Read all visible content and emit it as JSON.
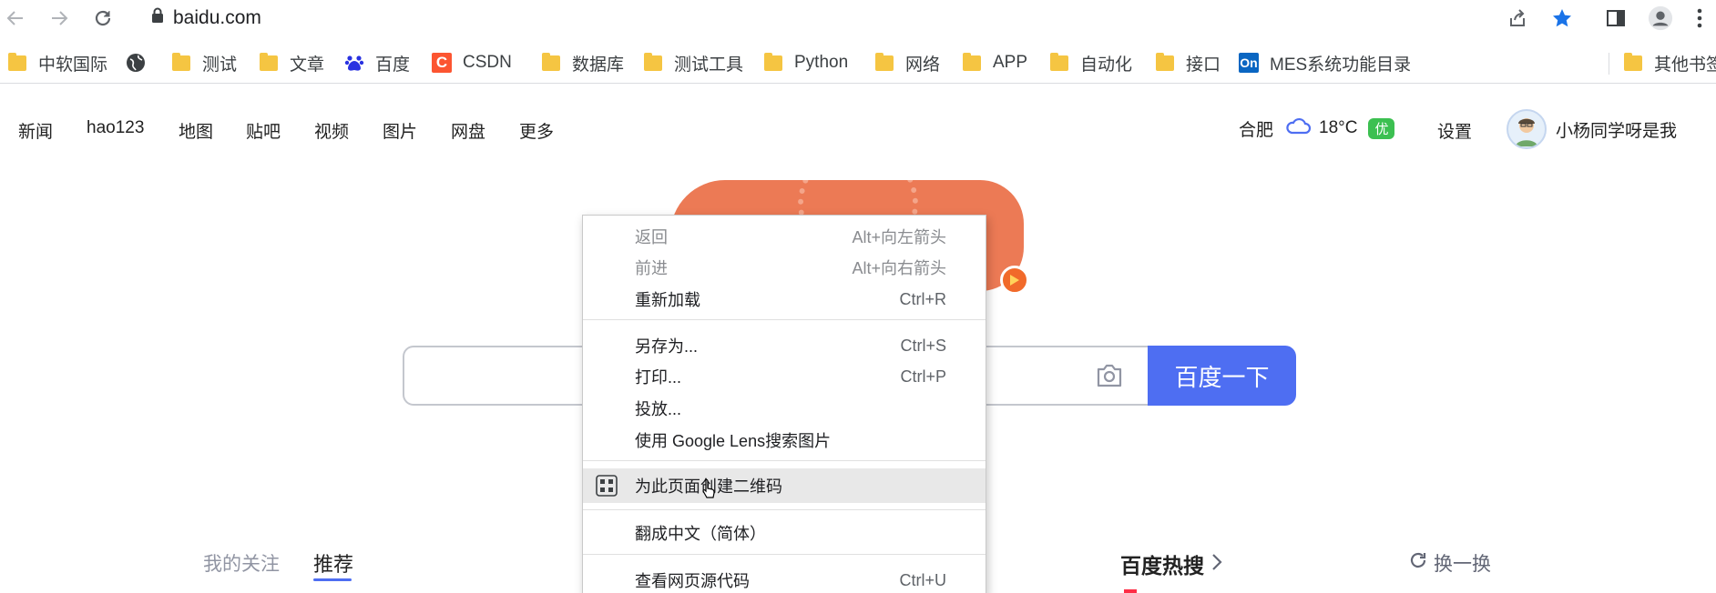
{
  "browser": {
    "url": "baidu.com"
  },
  "bookmarks": [
    {
      "label": "中软国际",
      "icon": "folder-icon"
    },
    {
      "label": "",
      "icon": "globe-icon"
    },
    {
      "label": "测试",
      "icon": "folder-icon"
    },
    {
      "label": "文章",
      "icon": "folder-icon"
    },
    {
      "label": "百度",
      "icon": "baidu-paw-icon"
    },
    {
      "label": "CSDN",
      "icon": "csdn-icon"
    },
    {
      "label": "数据库",
      "icon": "folder-icon"
    },
    {
      "label": "测试工具",
      "icon": "folder-icon"
    },
    {
      "label": "Python",
      "icon": "folder-icon"
    },
    {
      "label": "网络",
      "icon": "folder-icon"
    },
    {
      "label": "APP",
      "icon": "folder-icon"
    },
    {
      "label": "自动化",
      "icon": "folder-icon"
    },
    {
      "label": "接口",
      "icon": "folder-icon"
    },
    {
      "label": "MES系统功能目录",
      "icon": "on-icon"
    },
    {
      "label": "其他书签",
      "icon": "folder-icon"
    }
  ],
  "csdn_glyph": "C",
  "on_glyph": "On",
  "nav": [
    "新闻",
    "hao123",
    "地图",
    "贴吧",
    "视频",
    "图片",
    "网盘",
    "更多"
  ],
  "weather": {
    "city": "合肥",
    "temp": "18°C",
    "air_quality": "优"
  },
  "settings_label": "设置",
  "user_name": "小杨同学呀是我",
  "search": {
    "button_label": "百度一下"
  },
  "tabs": {
    "follow": "我的关注",
    "recommend": "推荐"
  },
  "hot": {
    "title": "百度热搜",
    "refresh": "换一换"
  },
  "context_menu": [
    {
      "label": "返回",
      "shortcut": "Alt+向左箭头",
      "disabled": true
    },
    {
      "label": "前进",
      "shortcut": "Alt+向右箭头",
      "disabled": true
    },
    {
      "label": "重新加载",
      "shortcut": "Ctrl+R",
      "disabled": false
    },
    {
      "label": "另存为...",
      "shortcut": "Ctrl+S",
      "disabled": false
    },
    {
      "label": "打印...",
      "shortcut": "Ctrl+P",
      "disabled": false
    },
    {
      "label": "投放...",
      "shortcut": "",
      "disabled": false
    },
    {
      "label": "使用 Google Lens搜索图片",
      "shortcut": "",
      "disabled": false
    },
    {
      "label": "为此页面创建二维码",
      "shortcut": "",
      "disabled": false,
      "highlighted": true,
      "icon": "qr-code-icon"
    },
    {
      "label": "翻成中文（简体）",
      "shortcut": "",
      "disabled": false
    },
    {
      "label": "查看网页源代码",
      "shortcut": "Ctrl+U",
      "disabled": false
    }
  ],
  "colors": {
    "baidu_blue": "#4e6ef2",
    "aq_green": "#3cc051",
    "hot_red": "#fe2d46",
    "star_blue": "#1a73e8"
  }
}
